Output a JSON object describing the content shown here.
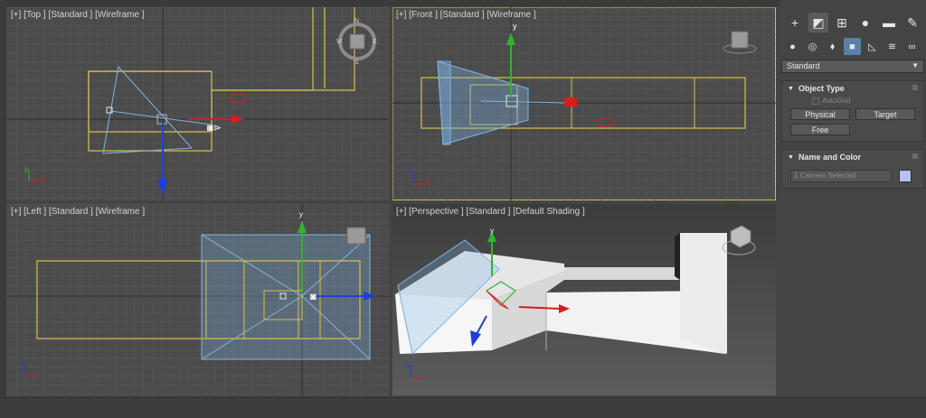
{
  "viewports": {
    "top": {
      "label": "[+] [Top ] [Standard ] [Wireframe ]"
    },
    "front": {
      "label": "[+] [Front ] [Standard ] [Wireframe ]"
    },
    "left": {
      "label": "[+] [Left ] [Standard ] [Wireframe ]"
    },
    "perspective": {
      "label": "[+] [Perspective ] [Standard ] [Default Shading ]"
    }
  },
  "viewcube": {
    "n": "N",
    "s": "S",
    "e": "E",
    "w": "W"
  },
  "axes": {
    "x": "x",
    "y": "y",
    "z": "z"
  },
  "command_panel": {
    "tabs": [
      "create-tab",
      "modify-tab",
      "hierarchy-tab",
      "motion-tab",
      "display-tab",
      "utilities-tab"
    ],
    "category_dropdown": "Standard",
    "object_type": {
      "title": "Object Type",
      "autogrid": "AutoGrid",
      "buttons": {
        "physical": "Physical",
        "target": "Target",
        "free": "Free"
      }
    },
    "name_and_color": {
      "title": "Name and Color",
      "name_value": "1 Camera Selected",
      "color": "#b6c2ee"
    }
  },
  "colors": {
    "selection": "#d8c04a",
    "camera": "#7fb4e6",
    "x_axis": "#d91c1c",
    "y_axis": "#2fb52f",
    "z_axis": "#1d3fd8"
  }
}
